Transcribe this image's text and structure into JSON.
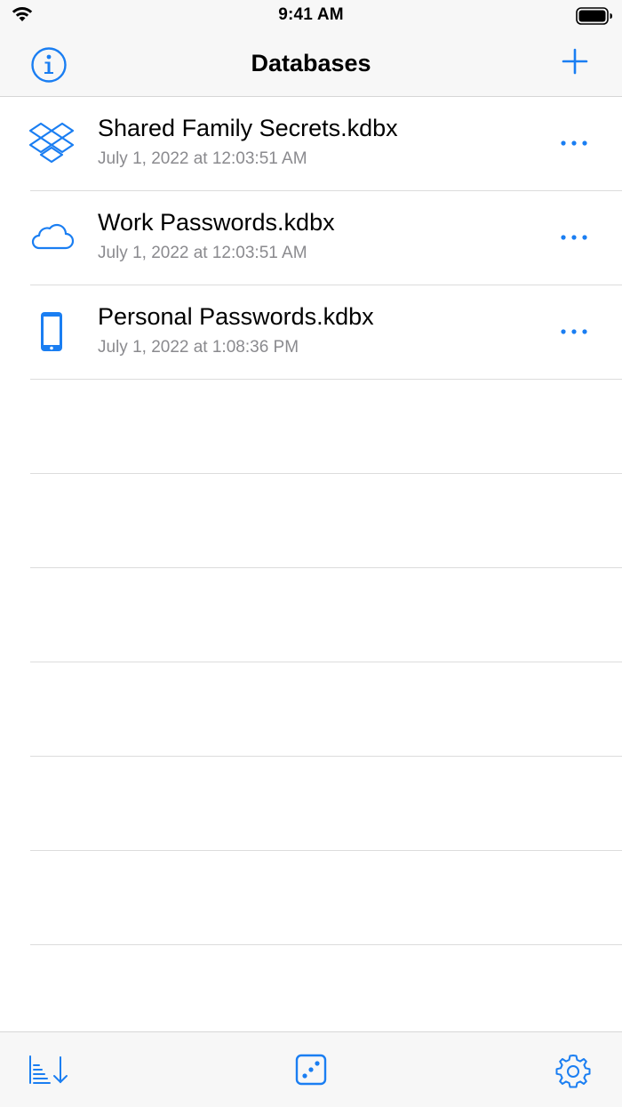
{
  "status_bar": {
    "time": "9:41 AM"
  },
  "nav": {
    "title": "Databases",
    "info_icon": "info-circle-icon",
    "add_icon": "plus-icon"
  },
  "accent_color": "#1a7ef2",
  "databases": [
    {
      "name": "Shared Family Secrets.kdbx",
      "date": "July 1, 2022 at 12:03:51 AM",
      "icon": "dropbox-icon"
    },
    {
      "name": "Work Passwords.kdbx",
      "date": "July 1, 2022 at 12:03:51 AM",
      "icon": "cloud-icon"
    },
    {
      "name": "Personal Passwords.kdbx",
      "date": "July 1, 2022 at 1:08:36 PM",
      "icon": "iphone-icon"
    }
  ],
  "toolbar": {
    "sort_icon": "sort-icon",
    "dice_icon": "dice-icon",
    "settings_icon": "gear-icon"
  }
}
